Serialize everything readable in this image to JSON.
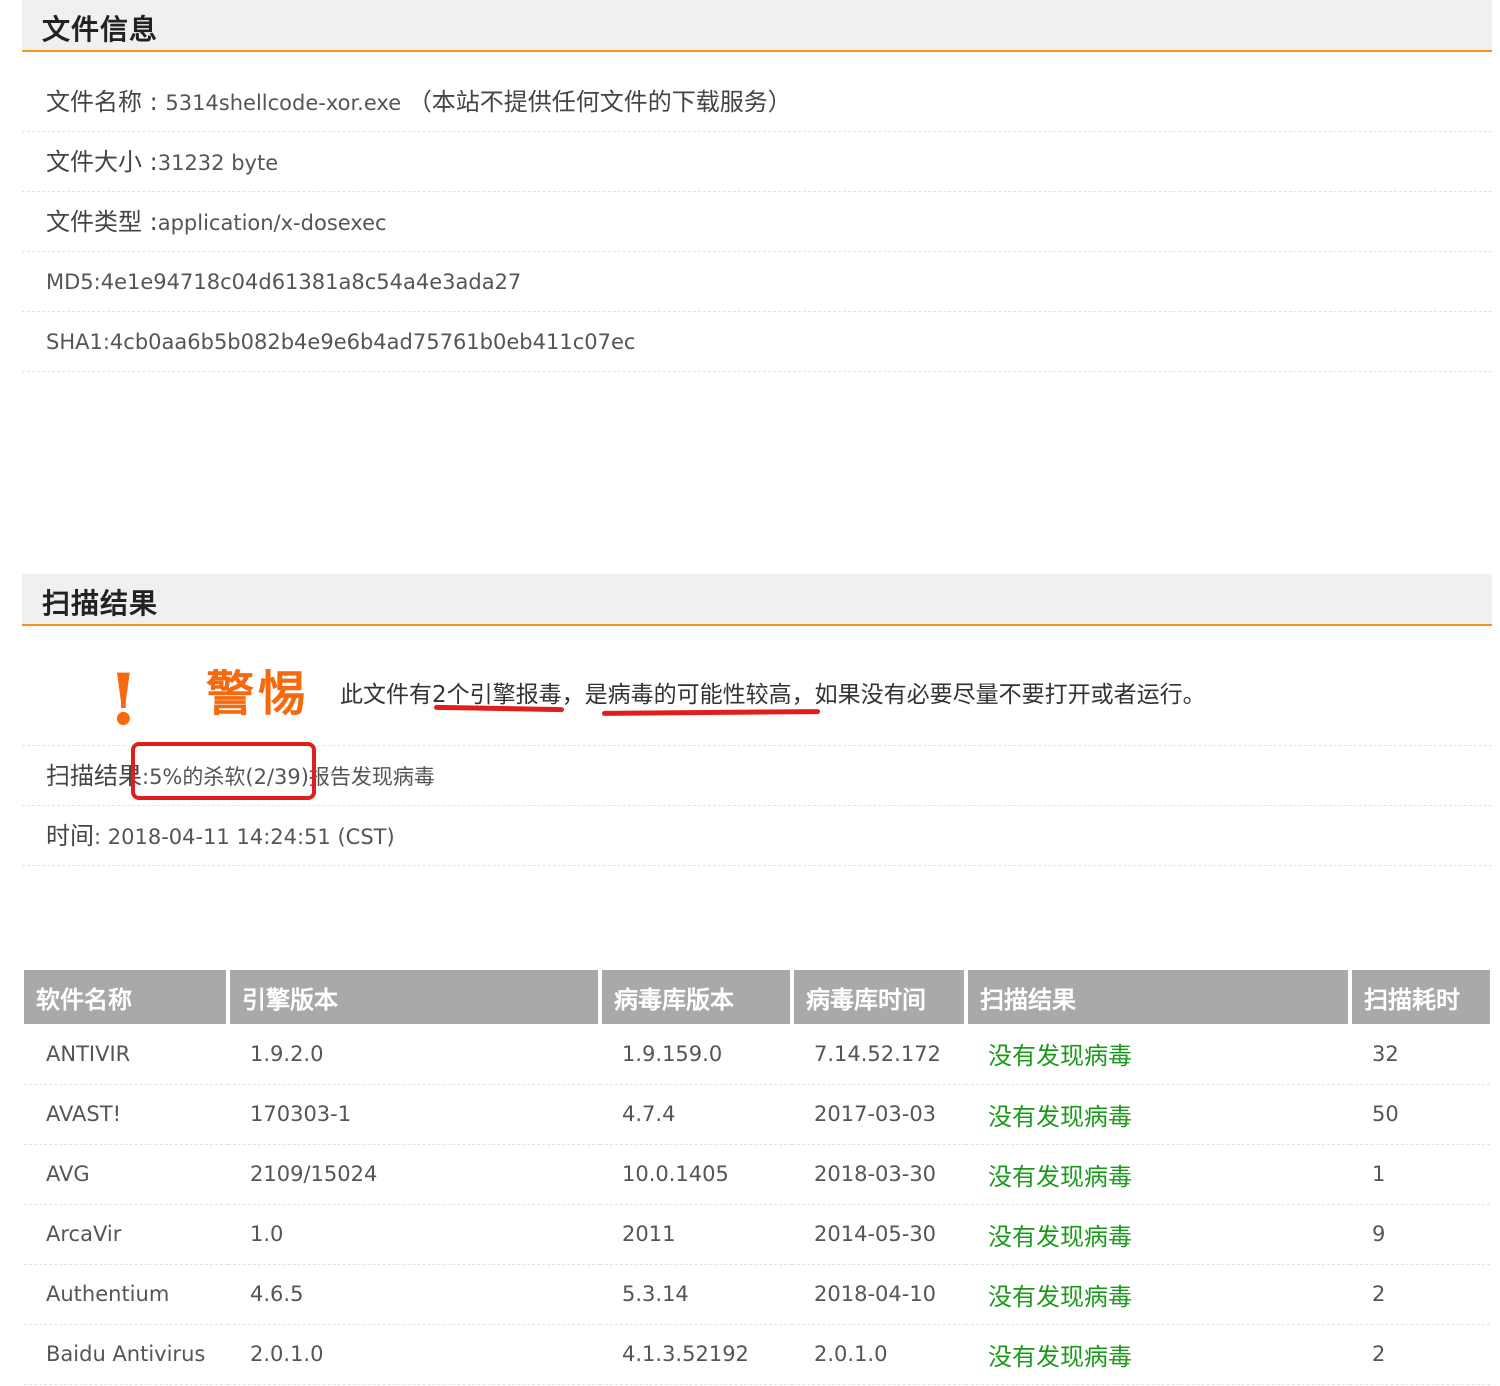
{
  "file_info": {
    "title": "文件信息",
    "name_label": "文件名称 : ",
    "name_value": "5314shellcode-xor.exe",
    "name_note": "（本站不提供任何文件的下载服务）",
    "size_label": "文件大小 :",
    "size_value": "31232 byte",
    "type_label": "文件类型 :",
    "type_value": "application/x-dosexec",
    "md5": "MD5:4e1e94718c04d61381a8c54a4e3ada27",
    "sha1": "SHA1:4cb0aa6b5b082b4e9e6b4ad75761b0eb411c07ec"
  },
  "scan": {
    "title": "扫描结果",
    "warn_mark": "!",
    "warn_word": "警惕",
    "warn_text": "此文件有2个引擎报毒，是病毒的可能性较高，如果没有必要尽量不要打开或者运行。",
    "result_label": "扫描结果",
    "result_value": ":5%的杀软(2/39)报告发现病毒",
    "time_label": "时间",
    "time_value": ": 2018-04-11 14:24:51 (CST)"
  },
  "table": {
    "headers": [
      "软件名称",
      "引擎版本",
      "病毒库版本",
      "病毒库时间",
      "扫描结果",
      "扫描耗时"
    ],
    "rows": [
      [
        "ANTIVIR",
        "1.9.2.0",
        "1.9.159.0",
        "7.14.52.172",
        "没有发现病毒",
        "32"
      ],
      [
        "AVAST!",
        "170303-1",
        "4.7.4",
        "2017-03-03",
        "没有发现病毒",
        "50"
      ],
      [
        "AVG",
        "2109/15024",
        "10.0.1405",
        "2018-03-30",
        "没有发现病毒",
        "1"
      ],
      [
        "ArcaVir",
        "1.0",
        "2011",
        "2014-05-30",
        "没有发现病毒",
        "9"
      ],
      [
        "Authentium",
        "4.6.5",
        "5.3.14",
        "2018-04-10",
        "没有发现病毒",
        "2"
      ],
      [
        "Baidu Antivirus",
        "2.0.1.0",
        "4.1.3.52192",
        "2.0.1.0",
        "没有发现病毒",
        "2"
      ]
    ]
  },
  "colors": {
    "accent": "#f39322",
    "warning": "#f56a0f",
    "clean_result": "#1a9a1a",
    "annotation": "#e01e1e",
    "table_header_bg": "#a9a9a9"
  }
}
